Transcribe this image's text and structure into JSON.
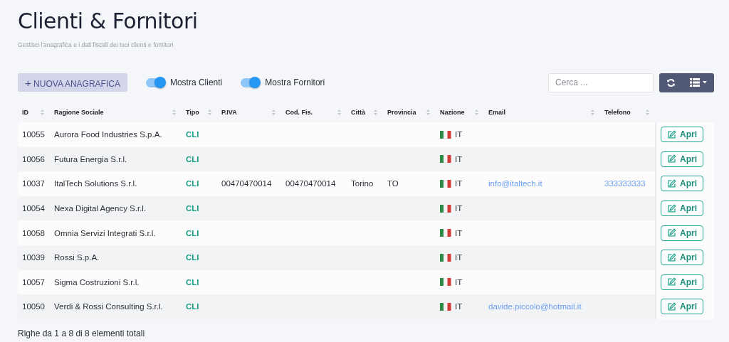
{
  "page": {
    "title": "Clienti & Fornitori",
    "subtitle": "Gestisci l'anagrafica e i dati fiscali dei tuoi clienti e fornitori"
  },
  "toolbar": {
    "new_button": {
      "icon": "+",
      "label": "NUOVA ANAGRAFICA"
    },
    "toggles": [
      {
        "label": "Mostra Clienti",
        "on": true
      },
      {
        "label": "Mostra Fornitori",
        "on": true
      }
    ],
    "search": {
      "placeholder": "Cerca ..."
    }
  },
  "table": {
    "columns": [
      "ID",
      "Ragione Sociale",
      "Tipo",
      "P.IVA",
      "Cod. Fis.",
      "Città",
      "Provincia",
      "Nazione",
      "Email",
      "Telefono"
    ],
    "rows": [
      {
        "id": "10055",
        "name": "Aurora Food Industries S.p.A.",
        "tipo": "CLI",
        "piva": "",
        "codfis": "",
        "citta": "",
        "provincia": "",
        "nazione": "IT",
        "email": "",
        "telefono": "",
        "action": "Apri"
      },
      {
        "id": "10056",
        "name": "Futura Energia S.r.l.",
        "tipo": "CLI",
        "piva": "",
        "codfis": "",
        "citta": "",
        "provincia": "",
        "nazione": "IT",
        "email": "",
        "telefono": "",
        "action": "Apri"
      },
      {
        "id": "10037",
        "name": "ItalTech Solutions S.r.l.",
        "tipo": "CLI",
        "piva": "00470470014",
        "codfis": "00470470014",
        "citta": "Torino",
        "provincia": "TO",
        "nazione": "IT",
        "email": "info@italtech.it",
        "telefono": "333333333",
        "action": "Apri"
      },
      {
        "id": "10054",
        "name": "Nexa Digital Agency S.r.l.",
        "tipo": "CLI",
        "piva": "",
        "codfis": "",
        "citta": "",
        "provincia": "",
        "nazione": "IT",
        "email": "",
        "telefono": "",
        "action": "Apri"
      },
      {
        "id": "10058",
        "name": "Omnia Servizi Integrati S.r.l.",
        "tipo": "CLI",
        "piva": "",
        "codfis": "",
        "citta": "",
        "provincia": "",
        "nazione": "IT",
        "email": "",
        "telefono": "",
        "action": "Apri"
      },
      {
        "id": "10039",
        "name": "Rossi S.p.A.",
        "tipo": "CLI",
        "piva": "",
        "codfis": "",
        "citta": "",
        "provincia": "",
        "nazione": "IT",
        "email": "",
        "telefono": "",
        "action": "Apri"
      },
      {
        "id": "10057",
        "name": "Sigma Costruzioni S.r.l.",
        "tipo": "CLI",
        "piva": "",
        "codfis": "",
        "citta": "",
        "provincia": "",
        "nazione": "IT",
        "email": "",
        "telefono": "",
        "action": "Apri"
      },
      {
        "id": "10050",
        "name": "Verdi & Rossi Consulting S.r.l.",
        "tipo": "CLI",
        "piva": "",
        "codfis": "",
        "citta": "",
        "provincia": "",
        "nazione": "IT",
        "email": "davide.piccolo@hotmail.it",
        "telefono": "",
        "action": "Apri"
      }
    ]
  },
  "footer": "Righe da 1 a 8 di 8 elementi totali"
}
